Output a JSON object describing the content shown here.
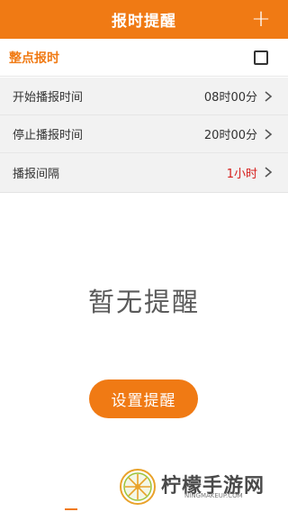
{
  "header": {
    "title": "报时提醒",
    "add_symbol": "+"
  },
  "whole_hour": {
    "label": "整点报时",
    "checked": false
  },
  "settings": [
    {
      "label": "开始播报时间",
      "value": "08时00分",
      "value_color": "#333333"
    },
    {
      "label": "停止播报时间",
      "value": "20时00分",
      "value_color": "#333333"
    },
    {
      "label": "播报间隔",
      "value": "1小时",
      "value_color": "#d6201d"
    }
  ],
  "empty_text": "暂无提醒",
  "action_button": "设置提醒",
  "watermark": {
    "text": "柠檬手游网",
    "sub": "NINGMAKEUP.COM"
  },
  "colors": {
    "accent": "#f07a14",
    "interval_value": "#d6201d"
  }
}
